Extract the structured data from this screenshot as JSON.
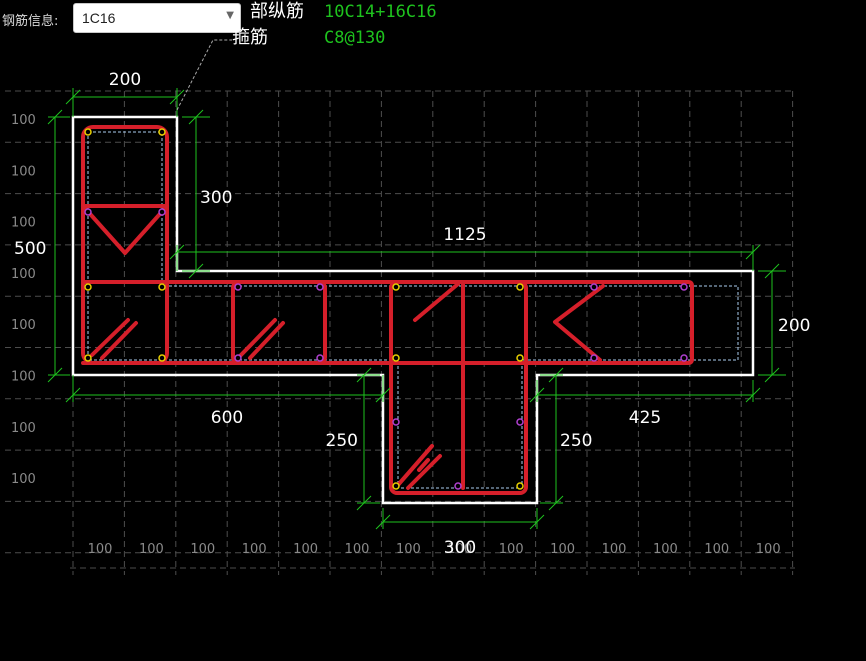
{
  "toolbar": {
    "rebar_info_label": "钢筋信息:",
    "rebar_select_value": "1C16"
  },
  "info": {
    "longitudinal_label": "部纵筋",
    "longitudinal_value": "10C14+16C16",
    "stirrup_label": "箍筋",
    "stirrup_value": "C8@130"
  },
  "dimensions": {
    "top_flange_width": "200",
    "top_flange_height": "300",
    "left_total_height": "500",
    "right_width": "1125",
    "right_height": "200",
    "left_bottom_width": "600",
    "bottom_web_left_height": "250",
    "bottom_web_width": "300",
    "bottom_web_right_height": "250",
    "right_bottom_width": "425"
  },
  "grid": {
    "left_labels": [
      "100",
      "100",
      "100",
      "100",
      "100",
      "100",
      "100",
      "100"
    ],
    "bottom_labels": [
      "100",
      "100",
      "100",
      "100",
      "100",
      "100",
      "100",
      "100",
      "100",
      "100",
      "100",
      "100",
      "100",
      "100"
    ]
  },
  "colors": {
    "section_outline": "#ffffff",
    "rebar": "#d51f2a",
    "dimension": "#1ec21e",
    "grid": "#5a5a5a"
  }
}
